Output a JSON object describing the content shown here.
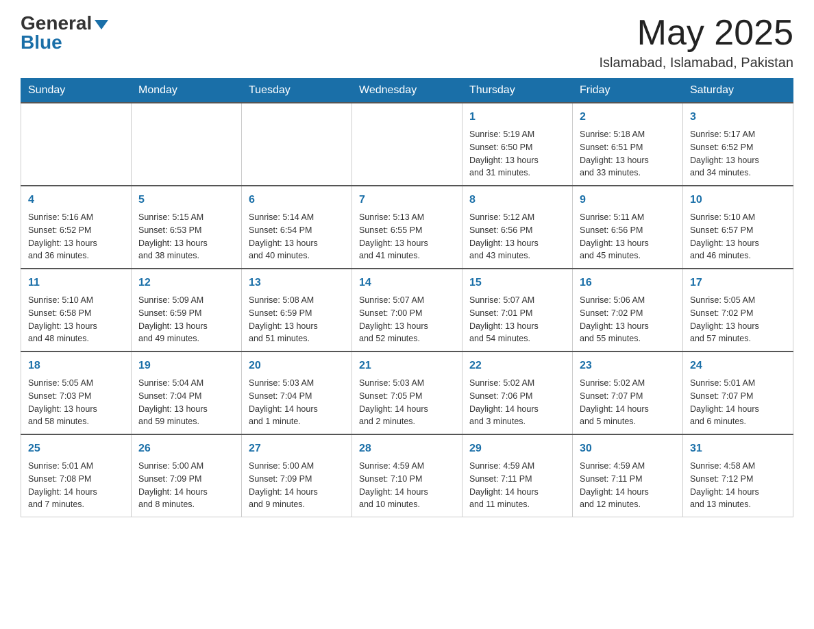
{
  "header": {
    "logo_general": "General",
    "logo_blue": "Blue",
    "month": "May 2025",
    "location": "Islamabad, Islamabad, Pakistan"
  },
  "days_of_week": [
    "Sunday",
    "Monday",
    "Tuesday",
    "Wednesday",
    "Thursday",
    "Friday",
    "Saturday"
  ],
  "weeks": [
    [
      {
        "day": "",
        "info": ""
      },
      {
        "day": "",
        "info": ""
      },
      {
        "day": "",
        "info": ""
      },
      {
        "day": "",
        "info": ""
      },
      {
        "day": "1",
        "info": "Sunrise: 5:19 AM\nSunset: 6:50 PM\nDaylight: 13 hours\nand 31 minutes."
      },
      {
        "day": "2",
        "info": "Sunrise: 5:18 AM\nSunset: 6:51 PM\nDaylight: 13 hours\nand 33 minutes."
      },
      {
        "day": "3",
        "info": "Sunrise: 5:17 AM\nSunset: 6:52 PM\nDaylight: 13 hours\nand 34 minutes."
      }
    ],
    [
      {
        "day": "4",
        "info": "Sunrise: 5:16 AM\nSunset: 6:52 PM\nDaylight: 13 hours\nand 36 minutes."
      },
      {
        "day": "5",
        "info": "Sunrise: 5:15 AM\nSunset: 6:53 PM\nDaylight: 13 hours\nand 38 minutes."
      },
      {
        "day": "6",
        "info": "Sunrise: 5:14 AM\nSunset: 6:54 PM\nDaylight: 13 hours\nand 40 minutes."
      },
      {
        "day": "7",
        "info": "Sunrise: 5:13 AM\nSunset: 6:55 PM\nDaylight: 13 hours\nand 41 minutes."
      },
      {
        "day": "8",
        "info": "Sunrise: 5:12 AM\nSunset: 6:56 PM\nDaylight: 13 hours\nand 43 minutes."
      },
      {
        "day": "9",
        "info": "Sunrise: 5:11 AM\nSunset: 6:56 PM\nDaylight: 13 hours\nand 45 minutes."
      },
      {
        "day": "10",
        "info": "Sunrise: 5:10 AM\nSunset: 6:57 PM\nDaylight: 13 hours\nand 46 minutes."
      }
    ],
    [
      {
        "day": "11",
        "info": "Sunrise: 5:10 AM\nSunset: 6:58 PM\nDaylight: 13 hours\nand 48 minutes."
      },
      {
        "day": "12",
        "info": "Sunrise: 5:09 AM\nSunset: 6:59 PM\nDaylight: 13 hours\nand 49 minutes."
      },
      {
        "day": "13",
        "info": "Sunrise: 5:08 AM\nSunset: 6:59 PM\nDaylight: 13 hours\nand 51 minutes."
      },
      {
        "day": "14",
        "info": "Sunrise: 5:07 AM\nSunset: 7:00 PM\nDaylight: 13 hours\nand 52 minutes."
      },
      {
        "day": "15",
        "info": "Sunrise: 5:07 AM\nSunset: 7:01 PM\nDaylight: 13 hours\nand 54 minutes."
      },
      {
        "day": "16",
        "info": "Sunrise: 5:06 AM\nSunset: 7:02 PM\nDaylight: 13 hours\nand 55 minutes."
      },
      {
        "day": "17",
        "info": "Sunrise: 5:05 AM\nSunset: 7:02 PM\nDaylight: 13 hours\nand 57 minutes."
      }
    ],
    [
      {
        "day": "18",
        "info": "Sunrise: 5:05 AM\nSunset: 7:03 PM\nDaylight: 13 hours\nand 58 minutes."
      },
      {
        "day": "19",
        "info": "Sunrise: 5:04 AM\nSunset: 7:04 PM\nDaylight: 13 hours\nand 59 minutes."
      },
      {
        "day": "20",
        "info": "Sunrise: 5:03 AM\nSunset: 7:04 PM\nDaylight: 14 hours\nand 1 minute."
      },
      {
        "day": "21",
        "info": "Sunrise: 5:03 AM\nSunset: 7:05 PM\nDaylight: 14 hours\nand 2 minutes."
      },
      {
        "day": "22",
        "info": "Sunrise: 5:02 AM\nSunset: 7:06 PM\nDaylight: 14 hours\nand 3 minutes."
      },
      {
        "day": "23",
        "info": "Sunrise: 5:02 AM\nSunset: 7:07 PM\nDaylight: 14 hours\nand 5 minutes."
      },
      {
        "day": "24",
        "info": "Sunrise: 5:01 AM\nSunset: 7:07 PM\nDaylight: 14 hours\nand 6 minutes."
      }
    ],
    [
      {
        "day": "25",
        "info": "Sunrise: 5:01 AM\nSunset: 7:08 PM\nDaylight: 14 hours\nand 7 minutes."
      },
      {
        "day": "26",
        "info": "Sunrise: 5:00 AM\nSunset: 7:09 PM\nDaylight: 14 hours\nand 8 minutes."
      },
      {
        "day": "27",
        "info": "Sunrise: 5:00 AM\nSunset: 7:09 PM\nDaylight: 14 hours\nand 9 minutes."
      },
      {
        "day": "28",
        "info": "Sunrise: 4:59 AM\nSunset: 7:10 PM\nDaylight: 14 hours\nand 10 minutes."
      },
      {
        "day": "29",
        "info": "Sunrise: 4:59 AM\nSunset: 7:11 PM\nDaylight: 14 hours\nand 11 minutes."
      },
      {
        "day": "30",
        "info": "Sunrise: 4:59 AM\nSunset: 7:11 PM\nDaylight: 14 hours\nand 12 minutes."
      },
      {
        "day": "31",
        "info": "Sunrise: 4:58 AM\nSunset: 7:12 PM\nDaylight: 14 hours\nand 13 minutes."
      }
    ]
  ]
}
